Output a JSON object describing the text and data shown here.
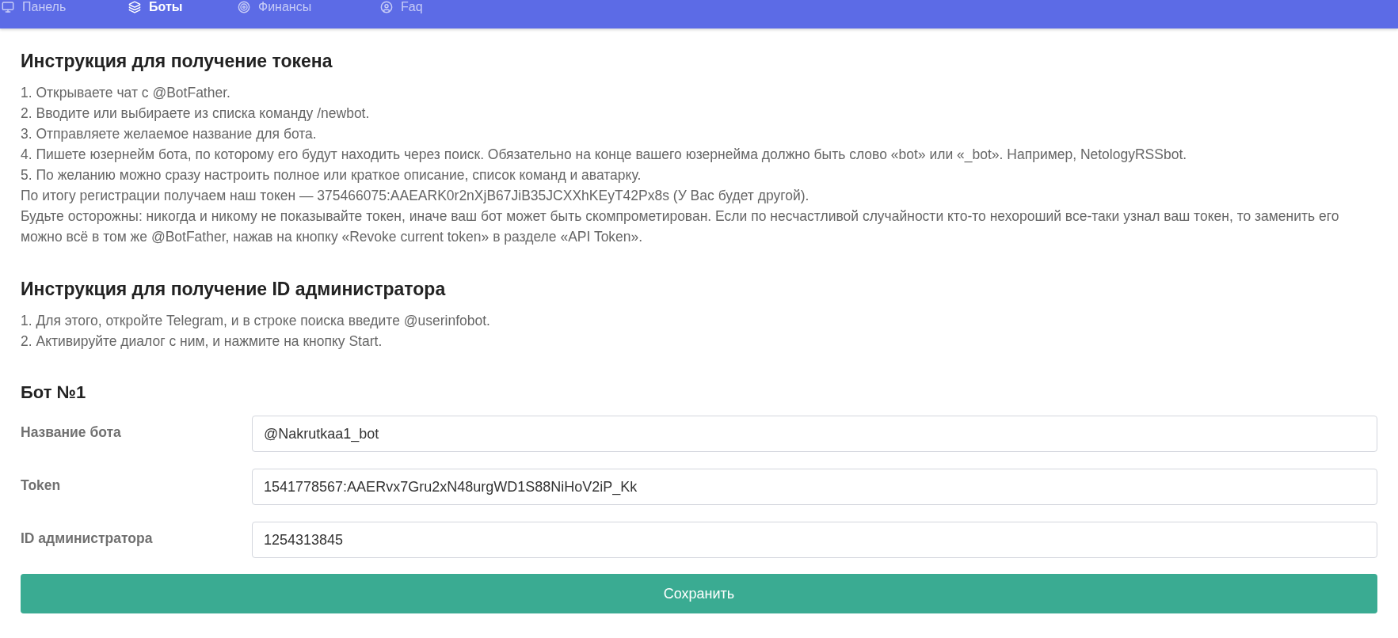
{
  "nav": {
    "items": [
      {
        "label": "Панель",
        "selected": false
      },
      {
        "label": "Боты",
        "selected": true
      },
      {
        "label": "Финансы",
        "selected": false
      },
      {
        "label": "Faq",
        "selected": false
      }
    ]
  },
  "sections": [
    {
      "title": "Инструкция для получение токена",
      "lines": [
        "1. Открываете чат с @BotFather.",
        "2. Вводите или выбираете из списка команду /newbot.",
        "3. Отправляете желаемое название для бота.",
        "4. Пишете юзернейм бота, по которому его будут находить через поиск. Обязательно на конце вашего юзернейма должно быть слово «bot» или «_bot». Например, NetologyRSSbot.",
        "5. По желанию можно сразу настроить полное или краткое описание, список команд и аватарку.",
        "По итогу регистрации получаем наш токен — 375466075:AAEARK0r2nXjB67JiB35JCXXhKEyT42Px8s (У Вас будет другой).",
        "Будьте осторожны: никогда и никому не показывайте токен, иначе ваш бот может быть скомпрометирован. Если по несчастливой случайности кто-то нехороший все-таки узнал ваш токен, то заменить его можно всё в том же @BotFather, нажав на кнопку «Revoke current token» в разделе «API Token»."
      ]
    },
    {
      "title": "Инструкция для получение ID администратора",
      "lines": [
        "1. Для этого, откройте Telegram, и в строке поиска введите @userinfobot.",
        "2. Активируйте диалог с ним, и нажмите на кнопку Start."
      ]
    }
  ],
  "bot_form": {
    "title": "Бот №1",
    "fields": [
      {
        "label": "Название бота",
        "value": "@Nakrutkaa1_bot"
      },
      {
        "label": "Token",
        "value": "1541778567:AAERvx7Gru2xN48urgWD1S88NiHoV2iP_Kk"
      },
      {
        "label": "ID администратора",
        "value": "1254313845"
      }
    ],
    "save_button": "Сохранить"
  }
}
